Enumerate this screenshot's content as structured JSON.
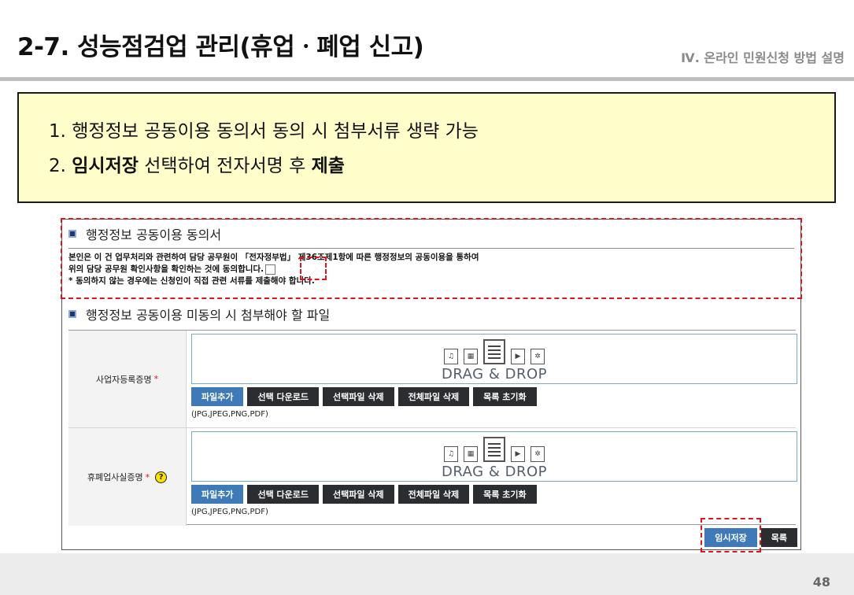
{
  "slide": {
    "title": "2-7. 성능점검업 관리(휴업ㆍ폐업 신고)",
    "section": "Ⅳ. 온라인 민원신청 방법 설명",
    "page_number": "48"
  },
  "note": {
    "line1": "1. 행정정보 공동이용 동의서 동의 시 첨부서류 생략 가능",
    "line2_prefix": "2. ",
    "line2_bold1": "임시저장",
    "line2_mid": " 선택하여 전자서명 후 ",
    "line2_bold2": "제출"
  },
  "consent": {
    "heading": "행정정보 공동이용 동의서",
    "text1": "본인은 이 건 업무처리와 관련하여 담당 공무원이 「전자정부법」 제36조제1항에 따른 행정정보의 공동이용을 통하여",
    "text2": "위의 담당 공무원 확인사항을 확인하는 것에 동의합니다.",
    "text3": "* 동의하지 않는 경우에는 신청인이 직접 관련 서류를 제출해야 합니다."
  },
  "attachments": {
    "heading": "행정정보 공동이용 미동의 시 첨부해야 할 파일",
    "drop_text": "DRAG & DROP",
    "allowed_ext": "(JPG,JPEG,PNG,PDF)",
    "buttons": {
      "add": "파일추가",
      "download": "선택 다운로드",
      "delete_selected": "선택파일 삭제",
      "delete_all": "전체파일 삭제",
      "reset": "목록 초기화"
    },
    "rows": [
      {
        "label": "사업자등록증명",
        "required": "*"
      },
      {
        "label": "휴폐업사실증명",
        "required": "*",
        "help": "?"
      }
    ]
  },
  "actions": {
    "temp_save": "임시저장",
    "list": "목록"
  },
  "colors": {
    "note_bg": "#fefecb",
    "highlight": "#e0141e",
    "primary_button": "#3e79b8",
    "dark_button": "#2b2d31"
  },
  "icons": [
    "music-file-icon",
    "image-file-icon",
    "document-file-icon",
    "video-file-icon",
    "settings-file-icon"
  ]
}
